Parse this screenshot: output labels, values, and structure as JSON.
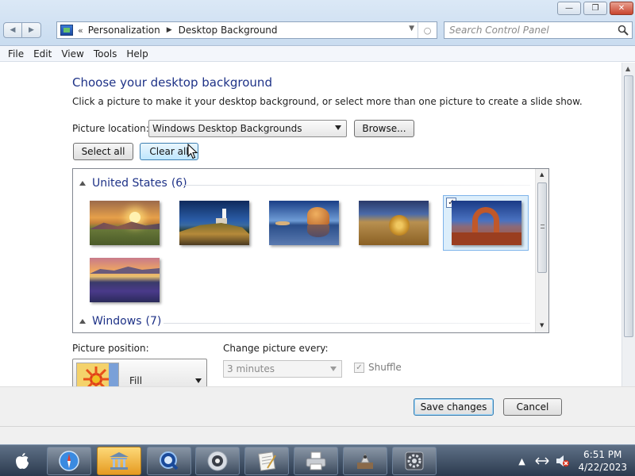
{
  "window": {
    "controls": {
      "minimize": "—",
      "maximize": "❐",
      "close": "✕"
    }
  },
  "address_bar": {
    "overflow": "«",
    "crumbs": [
      "Personalization",
      "Desktop Background"
    ]
  },
  "search": {
    "placeholder": "Search Control Panel"
  },
  "menu": [
    "File",
    "Edit",
    "View",
    "Tools",
    "Help"
  ],
  "main": {
    "heading": "Choose your desktop background",
    "subtitle": "Click a picture to make it your desktop background, or select more than one picture to create a slide show.",
    "location_label": "Picture location:",
    "location_value": "Windows Desktop Backgrounds",
    "browse_label": "Browse...",
    "select_all_label": "Select all",
    "clear_all_label": "Clear all",
    "groups": [
      {
        "name": "United States",
        "count": "(6)",
        "images": [
          {
            "name": "sunset-prairie",
            "selected": false
          },
          {
            "name": "lighthouse-coast",
            "selected": false
          },
          {
            "name": "rock-lake",
            "selected": false
          },
          {
            "name": "hay-bale",
            "selected": false
          },
          {
            "name": "delicate-arch",
            "selected": true
          },
          {
            "name": "lupine-lake",
            "selected": false
          }
        ]
      },
      {
        "name": "Windows",
        "count": "(7)",
        "images": []
      }
    ],
    "checkmark": "✓",
    "position_label": "Picture position:",
    "position_value": "Fill",
    "interval_label": "Change picture every:",
    "interval_value": "3 minutes",
    "shuffle_label": "Shuffle",
    "save_label": "Save changes",
    "cancel_label": "Cancel"
  },
  "taskbar": {
    "time": "6:51 PM",
    "date": "4/22/2023",
    "apps": [
      "safari",
      "library",
      "quicktime",
      "dvd-player",
      "text-editor",
      "printer",
      "preview",
      "system-preferences"
    ]
  },
  "colors": {
    "heading": "#1e3287",
    "selection": "#dceefb",
    "taskbar": "#2b3a4e"
  }
}
